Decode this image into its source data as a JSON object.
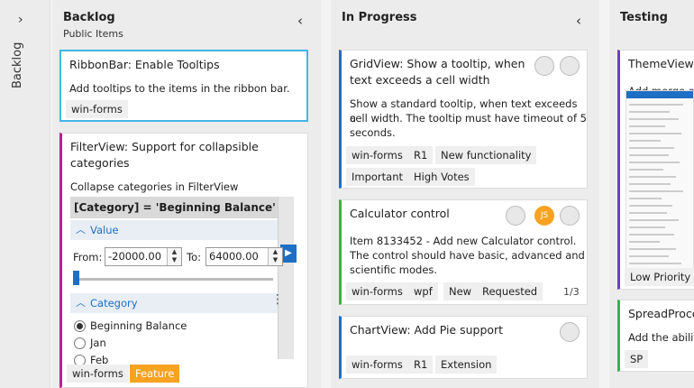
{
  "collapsed": {
    "chevron": "›",
    "label": "Backlog"
  },
  "backlog": {
    "title": "Backlog",
    "subtitle": "Public Items",
    "chevron": "‹",
    "cards": [
      {
        "title": "RibbonBar: Enable Tooltips",
        "desc": "Add tooltips to the items in the ribbon bar.",
        "tags": [
          "win-forms"
        ],
        "accent": "#3fb6e8"
      },
      {
        "title_l1": "FilterView: Support for collapsible",
        "title_l2": "categories",
        "desc": "Collapse categories in FilterView",
        "accent": "#b8218c",
        "filter": {
          "expression": "[Category] = 'Beginning Balance'",
          "value_section": "Value",
          "from_label": "From:",
          "from_value": "-20000.00",
          "to_label": "To:",
          "to_value": "64000.00",
          "category_section": "Category",
          "options": [
            "Beginning Balance",
            "Jan",
            "Feb"
          ],
          "selected_option": "Beginning Balance"
        },
        "tags": [
          "win-forms",
          "Feature"
        ]
      }
    ]
  },
  "inprogress": {
    "title": "In Progress",
    "chevron": "‹",
    "cards": [
      {
        "title_l1": "GridView: Show a tooltip, when",
        "title_l2": "text exceeds a cell width",
        "desc_l1": "Show a standard tooltip, when text exceeds a",
        "desc_l2": "cell width. The tooltip must have timeout of 5",
        "desc_l3": "seconds.",
        "tags": [
          "win-forms",
          "R1",
          "New functionality",
          "Important",
          "High Votes"
        ],
        "accent": "#1e6fc3"
      },
      {
        "title": "Calculator control",
        "avatar_initials": "JS",
        "desc_l1": "Item 8133452 - Add new Calculator control.",
        "desc_l2": "The control should have basic, advanced and",
        "desc_l3": "scientific modes.",
        "tags": [
          "win-forms",
          "wpf",
          "New",
          "Requested"
        ],
        "counter": "1/3",
        "accent": "#38b449"
      },
      {
        "title": "ChartView: Add Pie support",
        "tags": [
          "win-forms",
          "R1",
          "Extension"
        ],
        "accent": "#1e6fc3"
      }
    ]
  },
  "testing": {
    "title": "Testing",
    "cards": [
      {
        "title": "ThemeViewer",
        "desc": "Add merge op",
        "tags": [
          "Low Priority"
        ],
        "accent": "#6b3fc3"
      },
      {
        "title": "SpreadProce",
        "desc": "Add the ability",
        "tags": [
          "SP"
        ],
        "accent": "#38b449"
      }
    ]
  },
  "colors": {
    "accent_blue": "#1e6fc3",
    "feature_orange": "#f7a221"
  }
}
